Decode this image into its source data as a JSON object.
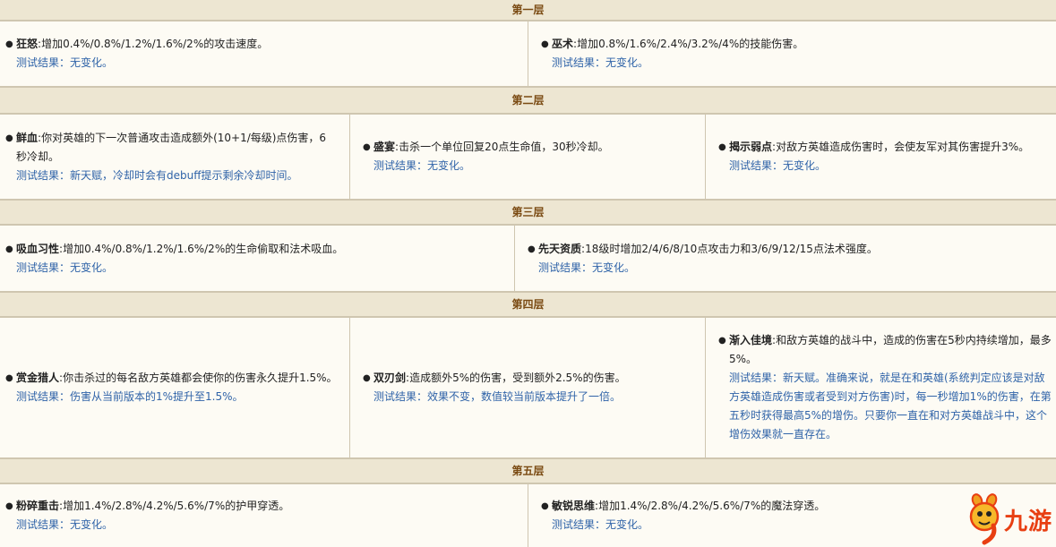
{
  "tiers": [
    {
      "title": "第一层",
      "items": [
        {
          "name": "狂怒",
          "desc": "增加0.4%/0.8%/1.2%/1.6%/2%的攻击速度。",
          "result": "测试结果：无变化。"
        },
        {
          "name": "巫术",
          "desc": "增加0.8%/1.6%/2.4%/3.2%/4%的技能伤害。",
          "result": "测试结果：无变化。"
        }
      ]
    },
    {
      "title": "第二层",
      "items": [
        {
          "name": "鲜血",
          "desc": "你对英雄的下一次普通攻击造成额外(10+1/每级)点伤害，6秒冷却。",
          "result": "测试结果：新天赋，冷却时会有debuff提示剩余冷却时间。"
        },
        {
          "name": "盛宴",
          "desc": "击杀一个单位回复20点生命值，30秒冷却。",
          "result": "测试结果：无变化。"
        },
        {
          "name": "揭示弱点",
          "desc": "对敌方英雄造成伤害时，会使友军对其伤害提升3%。",
          "result": "测试结果：无变化。"
        }
      ]
    },
    {
      "title": "第三层",
      "items": [
        {
          "name": "吸血习性",
          "desc": "增加0.4%/0.8%/1.2%/1.6%/2%的生命偷取和法术吸血。",
          "result": "测试结果：无变化。"
        },
        {
          "name": "先天资质",
          "desc": "18级时增加2/4/6/8/10点攻击力和3/6/9/12/15点法术强度。",
          "result": "测试结果：无变化。"
        }
      ]
    },
    {
      "title": "第四层",
      "items": [
        {
          "name": "赏金猎人",
          "desc": "你击杀过的每名敌方英雄都会使你的伤害永久提升1.5%。",
          "result": "测试结果：伤害从当前版本的1%提升至1.5%。"
        },
        {
          "name": "双刃剑",
          "desc": "造成额外5%的伤害，受到额外2.5%的伤害。",
          "result": "测试结果：效果不变，数值较当前版本提升了一倍。"
        },
        {
          "name": "渐入佳境",
          "desc": "和敌方英雄的战斗中，造成的伤害在5秒内持续增加，最多5%。",
          "result": "测试结果：新天赋。准确来说，就是在和英雄(系统判定应该是对敌方英雄造成伤害或者受到对方伤害)时，每一秒增加1%的伤害，在第五秒时获得最高5%的增伤。只要你一直在和对方英雄战斗中，这个增伤效果就一直存在。"
        }
      ]
    },
    {
      "title": "第五层",
      "items": [
        {
          "name": "粉碎重击",
          "desc": "增加1.4%/2.8%/4.2%/5.6%/7%的护甲穿透。",
          "result": "测试结果：无变化。"
        },
        {
          "name": "敏锐思维",
          "desc": "增加1.4%/2.8%/4.2%/5.6%/7%的魔法穿透。",
          "result": "测试结果：无变化。"
        }
      ]
    }
  ],
  "logo": {
    "text": "九游",
    "icon": "mascot-9-icon",
    "color": "#e83f12"
  }
}
